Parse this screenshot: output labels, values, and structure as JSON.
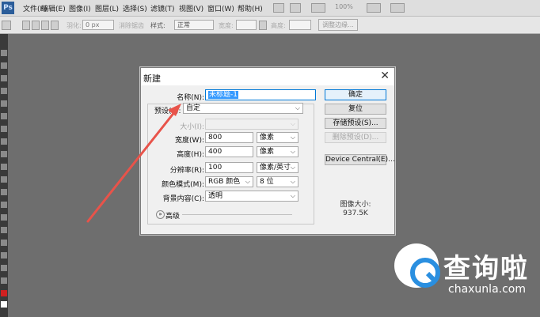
{
  "menu": {
    "items": [
      "文件(F)",
      "编辑(E)",
      "图像(I)",
      "图层(L)",
      "选择(S)",
      "滤镜(T)",
      "视图(V)",
      "窗口(W)",
      "帮助(H)"
    ],
    "zoom": "100%"
  },
  "options": {
    "feather_label": "羽化:",
    "feather_value": "0 px",
    "antialias_label": "消除锯齿",
    "style_label": "样式:",
    "style_value": "正常",
    "width_label": "宽度:",
    "height_label": "高度:",
    "refine_button": "调整边缘..."
  },
  "dialog": {
    "title": "新建",
    "name_label": "名称(N):",
    "name_value": "未标题-1",
    "preset_label": "预设(P):",
    "preset_value": "自定",
    "size_label": "大小(I):",
    "width_label": "宽度(W):",
    "width_value": "800",
    "width_unit": "像素",
    "height_label": "高度(H):",
    "height_value": "400",
    "height_unit": "像素",
    "resolution_label": "分辨率(R):",
    "resolution_value": "100",
    "resolution_unit": "像素/英寸",
    "color_mode_label": "颜色模式(M):",
    "color_mode_value": "RGB 颜色",
    "bit_depth_value": "8 位",
    "background_label": "背景内容(C):",
    "background_value": "透明",
    "advanced_label": "高级",
    "buttons": {
      "ok": "确定",
      "reset": "复位",
      "save_preset": "存储预设(S)...",
      "delete_preset": "删除预设(D)...",
      "device_central": "Device Central(E)..."
    },
    "image_size_label": "图像大小:",
    "image_size_value": "937.5K"
  },
  "watermark": {
    "cn": "查询啦",
    "en": "chaxunla.com"
  },
  "colors": {
    "arrow": "#e8534a",
    "accent": "#0078d7",
    "selection": "#3399ff",
    "watermark_blue": "#2a8fe0"
  }
}
